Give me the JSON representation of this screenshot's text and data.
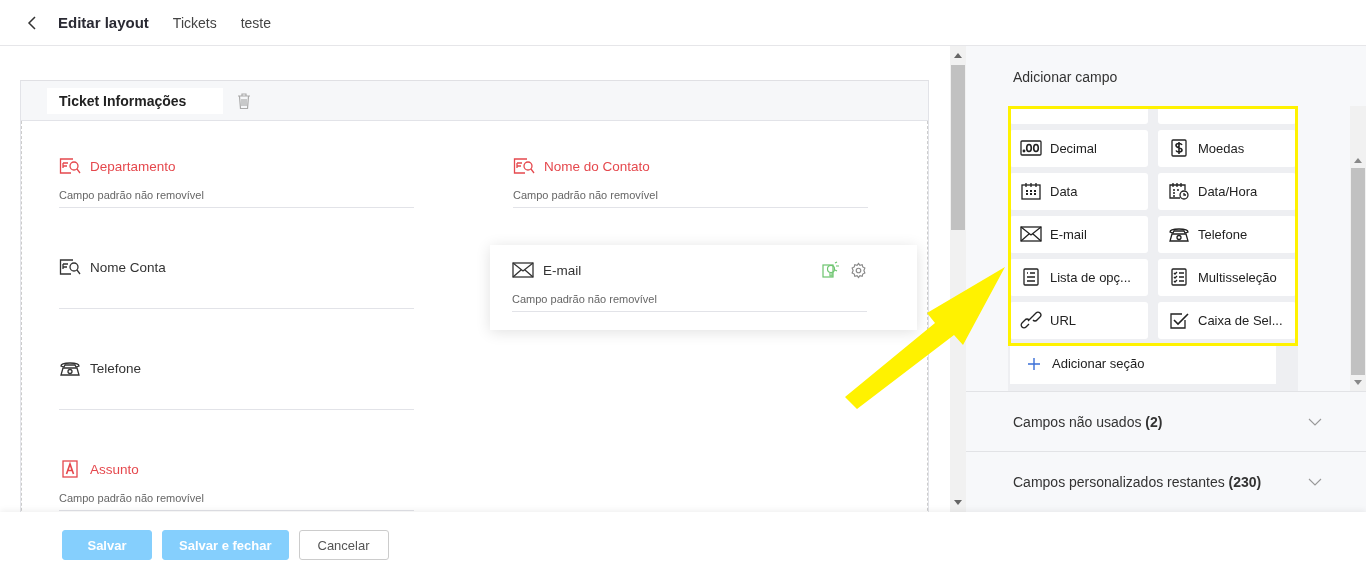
{
  "header": {
    "title": "Editar layout",
    "breadcrumbs": [
      "Tickets",
      "teste"
    ]
  },
  "section": {
    "title": "Ticket Informações",
    "rows": [
      [
        {
          "label": "Departamento",
          "kind": "lookup",
          "required": true,
          "hint": "Campo padrão não removível"
        },
        {
          "label": "Nome do Contato",
          "kind": "lookup",
          "required": true,
          "hint": "Campo padrão não removível"
        }
      ],
      [
        {
          "label": "Nome Conta",
          "kind": "lookup",
          "required": false
        }
      ],
      [
        {
          "label": "Telefone",
          "kind": "phone",
          "required": false
        }
      ],
      [
        {
          "label": "Assunto",
          "kind": "text",
          "required": true,
          "hint": "Campo padrão não removível"
        }
      ]
    ]
  },
  "dragged_field": {
    "label": "E-mail",
    "kind": "email",
    "required": false,
    "hint": "Campo padrão não removível"
  },
  "palette": {
    "title": "Adicionar campo",
    "tiles": [
      {
        "label": "Decimal",
        "kind": "decimal"
      },
      {
        "label": "Moedas",
        "kind": "currency"
      },
      {
        "label": "Data",
        "kind": "date"
      },
      {
        "label": "Data/Hora",
        "kind": "datetime"
      },
      {
        "label": "E-mail",
        "kind": "email"
      },
      {
        "label": "Telefone",
        "kind": "phone"
      },
      {
        "label": "Lista de opç...",
        "kind": "picklist"
      },
      {
        "label": "Multisseleção",
        "kind": "multiselect"
      },
      {
        "label": "URL",
        "kind": "url"
      },
      {
        "label": "Caixa de Sel...",
        "kind": "checkbox"
      }
    ],
    "add_section": "Adicionar seção"
  },
  "accordions": [
    {
      "label": "Campos não usados",
      "count": "(2)",
      "expanded": false
    },
    {
      "label": "Campos personalizados restantes",
      "count": "(230)",
      "expanded": false
    }
  ],
  "footer": {
    "buttons": [
      {
        "label": "Salvar",
        "kind": "primary",
        "disabled": true
      },
      {
        "label": "Salvar e fechar",
        "kind": "primary",
        "disabled": true
      },
      {
        "label": "Cancelar",
        "kind": "secondary",
        "disabled": false
      }
    ]
  }
}
